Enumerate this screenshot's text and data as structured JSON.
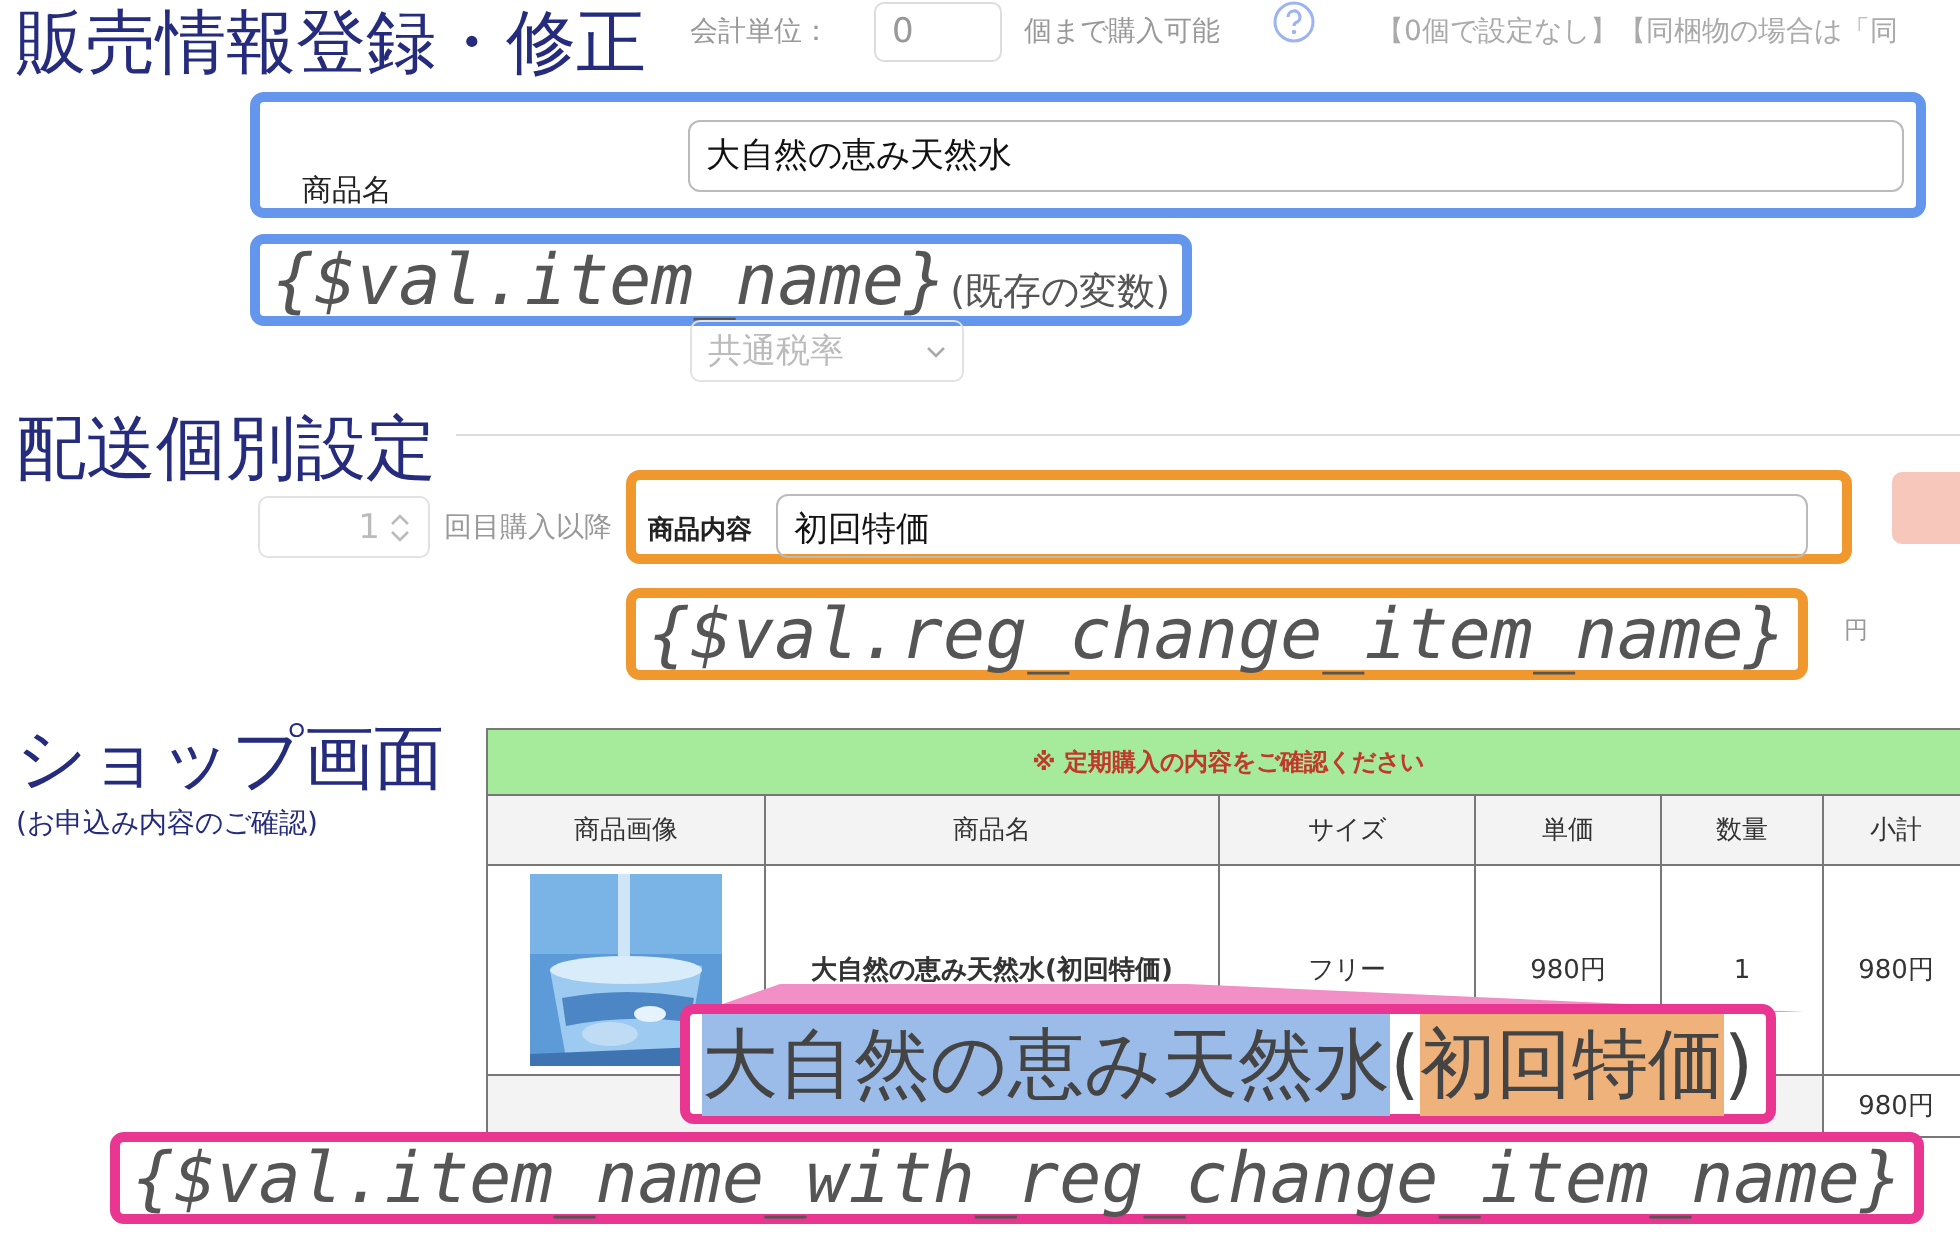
{
  "page_title": "販売情報登録・修正",
  "unit_row": {
    "label": "会計単位：",
    "value": "0",
    "suffix": "個まで購入可能",
    "note": "【0個で設定なし】【同梱物の場合は「同"
  },
  "item_name_field": {
    "label": "商品名",
    "value": "大自然の恵み天然水"
  },
  "item_name_variable": {
    "code": "{$val.item_name}",
    "note": "(既存の変数)"
  },
  "tax_select": {
    "value": "共通税率"
  },
  "shipping_heading": "配送個別設定",
  "repeat_row": {
    "value": "1",
    "suffix": "回目購入以降"
  },
  "content_field": {
    "label": "商品内容",
    "value": "初回特価"
  },
  "content_variable": {
    "code": "{$val.reg_change_item_name}"
  },
  "price_unit": "円",
  "shop_heading": "ショップ画面",
  "shop_subheading": "(お申込み内容のご確認)",
  "order_table": {
    "banner": "※ 定期購入の内容をご確認ください",
    "columns": [
      "商品画像",
      "商品名",
      "サイズ",
      "単価",
      "数量",
      "小計"
    ],
    "item_row": {
      "name": "大自然の恵み天然水(初回特価)",
      "size": "フリー",
      "price": "980円",
      "quantity": "1",
      "subtotal": "980円"
    },
    "total_row": {
      "subtotal": "980円"
    }
  },
  "zoom_callout": {
    "name_part": "大自然の恵み天然水",
    "open": "(",
    "variant_part": "初回特価",
    "close": ")"
  },
  "combined_variable": {
    "code": "{$val.item_name_with_reg_change_item_name}"
  }
}
